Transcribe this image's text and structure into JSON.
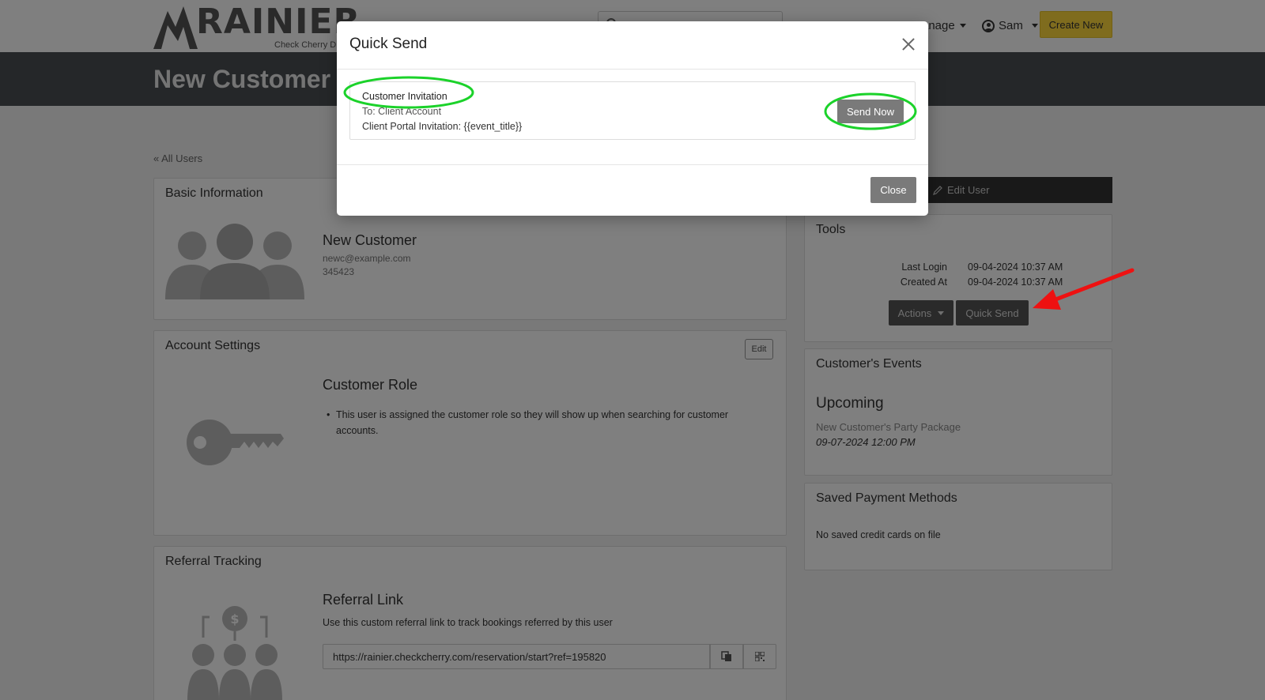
{
  "nav": {
    "logo_text": "RAINIER",
    "logo_sub": "Check Cherry D",
    "manage_label": "anage",
    "user_label": "Sam",
    "create_label": "Create New"
  },
  "header": {
    "title": "New Customer"
  },
  "back_link": "« All Users",
  "basic": {
    "title": "Basic Information",
    "name": "New Customer",
    "email": "newc@example.com",
    "phone": "345423"
  },
  "account": {
    "title": "Account Settings",
    "edit_label": "Edit",
    "role_heading": "Customer Role",
    "role_text": "This user is assigned the customer role so they will show up when searching for customer accounts."
  },
  "referral": {
    "title": "Referral Tracking",
    "heading": "Referral Link",
    "desc": "Use this custom referral link to track bookings referred by this user",
    "link": "https://rainier.checkcherry.com/reservation/start?ref=195820"
  },
  "edit_user_label": "Edit User",
  "tools": {
    "title": "Tools",
    "last_login_label": "Last Login",
    "last_login_value": "09-04-2024 10:37 AM",
    "created_label": "Created At",
    "created_value": "09-04-2024 10:37 AM",
    "actions_label": "Actions",
    "quick_send_label": "Quick Send"
  },
  "events": {
    "title": "Customer's Events",
    "upcoming": "Upcoming",
    "event_name": "New Customer's Party Package",
    "event_date": "09-07-2024 12:00 PM"
  },
  "payment": {
    "title": "Saved Payment Methods",
    "empty": "No saved credit cards on file"
  },
  "modal": {
    "title": "Quick Send",
    "template_name": "Customer Invitation",
    "template_to": "To: Client Account",
    "template_subject": "Client Portal Invitation: {{event_title}}",
    "send_now_label": "Send Now",
    "close_label": "Close"
  },
  "colors": {
    "accent_yellow": "#ffd83d",
    "header_dark": "#4a4e52",
    "highlight_green": "#1bd22a",
    "arrow_red": "#ee1111"
  }
}
